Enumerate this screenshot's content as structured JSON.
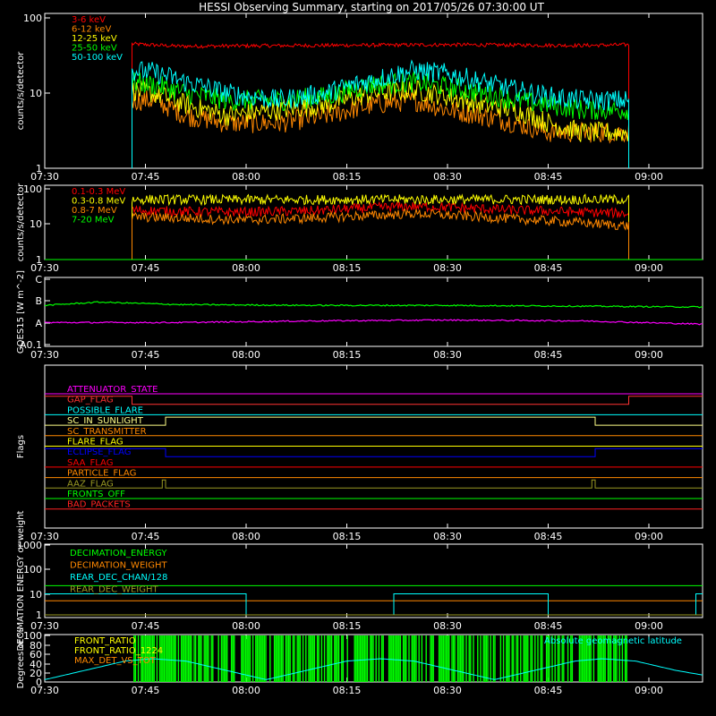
{
  "chart_data": {
    "type": "line",
    "title": "HESSI Observing Summary, starting on 2017/05/26 07:30:00 UT",
    "time_ticks": [
      "07:30",
      "07:45",
      "08:00",
      "08:15",
      "08:30",
      "08:45",
      "09:00"
    ],
    "time_range_min": [
      0,
      98
    ],
    "panels": [
      {
        "id": "low-energy",
        "ylabel": "counts/s/detector",
        "yscale": "log",
        "ylim": [
          1,
          100
        ],
        "ytick_labels": [
          "1",
          "10",
          "100"
        ],
        "series": [
          {
            "name": "3-6 keV",
            "color": "#ff0000",
            "values": [
              [
                13,
                45
              ],
              [
                20,
                42
              ],
              [
                40,
                43
              ],
              [
                60,
                44
              ],
              [
                80,
                43
              ],
              [
                87,
                44
              ]
            ]
          },
          {
            "name": "6-12 keV",
            "color": "#ff8800",
            "values": [
              [
                13,
                8
              ],
              [
                16,
                8
              ],
              [
                21,
                5
              ],
              [
                27,
                4
              ],
              [
                35,
                4
              ],
              [
                42,
                5
              ],
              [
                49,
                7
              ],
              [
                55,
                8
              ],
              [
                60,
                6
              ],
              [
                65,
                5
              ],
              [
                70,
                4
              ],
              [
                75,
                3
              ],
              [
                80,
                3
              ],
              [
                87,
                3
              ]
            ]
          },
          {
            "name": "12-25 keV",
            "color": "#ffff00",
            "values": [
              [
                13,
                11
              ],
              [
                16,
                10
              ],
              [
                21,
                7
              ],
              [
                27,
                5
              ],
              [
                35,
                6
              ],
              [
                42,
                7
              ],
              [
                49,
                10
              ],
              [
                55,
                11
              ],
              [
                60,
                9
              ],
              [
                65,
                7
              ],
              [
                70,
                6
              ],
              [
                75,
                4
              ],
              [
                80,
                3
              ],
              [
                87,
                3
              ]
            ]
          },
          {
            "name": "25-50 keV",
            "color": "#00ff00",
            "values": [
              [
                13,
                14
              ],
              [
                16,
                13
              ],
              [
                21,
                10
              ],
              [
                27,
                8
              ],
              [
                35,
                8
              ],
              [
                42,
                9
              ],
              [
                49,
                13
              ],
              [
                55,
                14
              ],
              [
                60,
                12
              ],
              [
                65,
                10
              ],
              [
                70,
                8
              ],
              [
                75,
                7
              ],
              [
                80,
                6
              ],
              [
                87,
                6
              ]
            ]
          },
          {
            "name": "50-100 keV",
            "color": "#00ffff",
            "values": [
              [
                13,
                20
              ],
              [
                16,
                19
              ],
              [
                21,
                14
              ],
              [
                27,
                10
              ],
              [
                35,
                8
              ],
              [
                42,
                10
              ],
              [
                49,
                15
              ],
              [
                55,
                20
              ],
              [
                60,
                18
              ],
              [
                65,
                14
              ],
              [
                70,
                11
              ],
              [
                75,
                9
              ],
              [
                80,
                8
              ],
              [
                87,
                8
              ]
            ]
          }
        ]
      },
      {
        "id": "high-energy",
        "ylabel": "counts/s/detector",
        "yscale": "log",
        "ylim": [
          1,
          100
        ],
        "ytick_labels": [
          "1",
          "10",
          "100"
        ],
        "series": [
          {
            "name": "0.1-0.3 MeV",
            "color": "#ff0000",
            "values": [
              [
                13,
                25
              ],
              [
                20,
                23
              ],
              [
                30,
                22
              ],
              [
                40,
                24
              ],
              [
                50,
                30
              ],
              [
                55,
                32
              ],
              [
                60,
                30
              ],
              [
                70,
                25
              ],
              [
                80,
                22
              ],
              [
                87,
                20
              ]
            ]
          },
          {
            "name": "0.3-0.8 MeV",
            "color": "#ffff00",
            "values": [
              [
                13,
                50
              ],
              [
                30,
                49
              ],
              [
                50,
                50
              ],
              [
                70,
                50
              ],
              [
                87,
                50
              ]
            ]
          },
          {
            "name": "0.8-7 MeV",
            "color": "#ff8800",
            "values": [
              [
                13,
                16
              ],
              [
                20,
                15
              ],
              [
                30,
                13
              ],
              [
                40,
                15
              ],
              [
                50,
                18
              ],
              [
                55,
                20
              ],
              [
                60,
                18
              ],
              [
                70,
                14
              ],
              [
                80,
                11
              ],
              [
                87,
                9
              ]
            ]
          },
          {
            "name": "7-20 MeV",
            "color": "#00ff00",
            "values": [
              [
                0,
                1
              ],
              [
                98,
                1
              ]
            ]
          }
        ]
      },
      {
        "id": "goes",
        "ylabel": "GOES15 [W m^-2]",
        "ytick_labels": [
          "A0.1",
          "A",
          "B",
          "C"
        ],
        "series": [
          {
            "name": "",
            "color": "#00ff00",
            "values": [
              [
                0,
                6.0
              ],
              [
                8,
                6.2
              ],
              [
                20,
                6.05
              ],
              [
                40,
                6.0
              ],
              [
                60,
                6.0
              ],
              [
                80,
                5.95
              ],
              [
                98,
                5.9
              ]
            ]
          },
          {
            "name": "",
            "color": "#ff00ff",
            "values": [
              [
                0,
                4.95
              ],
              [
                20,
                4.95
              ],
              [
                40,
                5.05
              ],
              [
                60,
                5.1
              ],
              [
                80,
                5.05
              ],
              [
                98,
                4.85
              ]
            ]
          }
        ]
      },
      {
        "id": "flags",
        "ylabel": "Flags",
        "flags": [
          {
            "name": "ATTENUATOR_STATE",
            "color": "#ff00ff",
            "values": [
              [
                0,
                0
              ],
              [
                98,
                0
              ]
            ]
          },
          {
            "name": "GAP_FLAG",
            "color": "#ff3333",
            "values": [
              [
                0,
                1
              ],
              [
                13,
                1
              ],
              [
                13,
                0
              ],
              [
                87,
                0
              ],
              [
                87,
                1
              ],
              [
                98,
                1
              ]
            ]
          },
          {
            "name": "POSSIBLE_FLARE",
            "color": "#00ffff",
            "values": [
              [
                0,
                0
              ],
              [
                98,
                0
              ]
            ]
          },
          {
            "name": "SC_IN_SUNLIGHT",
            "color": "#ffff88",
            "values": [
              [
                0,
                0
              ],
              [
                18,
                0
              ],
              [
                18,
                1
              ],
              [
                82,
                1
              ],
              [
                82,
                0
              ],
              [
                98,
                0
              ]
            ]
          },
          {
            "name": "SC_TRANSMITTER",
            "color": "#ff8800",
            "values": [
              [
                0,
                0
              ],
              [
                98,
                0
              ]
            ]
          },
          {
            "name": "FLARE_FLAG",
            "color": "#ffff00",
            "values": [
              [
                0,
                0
              ],
              [
                98,
                0
              ]
            ]
          },
          {
            "name": "ECLIPSE_FLAG",
            "color": "#0000ff",
            "values": [
              [
                0,
                1
              ],
              [
                18,
                1
              ],
              [
                18,
                0
              ],
              [
                82,
                0
              ],
              [
                82,
                1
              ],
              [
                98,
                1
              ]
            ]
          },
          {
            "name": "SAA_FLAG",
            "color": "#ff0000",
            "values": [
              [
                0,
                0
              ],
              [
                98,
                0
              ]
            ]
          },
          {
            "name": "PARTICLE_FLAG",
            "color": "#ff8800",
            "values": [
              [
                0,
                0
              ],
              [
                98,
                0
              ]
            ]
          },
          {
            "name": "AAZ_FLAG",
            "color": "#999922",
            "values": [
              [
                0,
                0
              ],
              [
                17.5,
                0
              ],
              [
                17.5,
                1
              ],
              [
                18,
                1
              ],
              [
                18,
                0
              ],
              [
                81.5,
                0
              ],
              [
                81.5,
                1
              ],
              [
                82,
                1
              ],
              [
                82,
                0
              ],
              [
                98,
                0
              ]
            ]
          },
          {
            "name": "FRONTS_OFF",
            "color": "#00ff00",
            "values": [
              [
                0,
                0
              ],
              [
                98,
                0
              ]
            ]
          },
          {
            "name": "BAD_PACKETS",
            "color": "#ff2222",
            "values": [
              [
                0,
                0
              ],
              [
                98,
                0
              ]
            ]
          }
        ]
      },
      {
        "id": "decimation",
        "ylabel": "DECIMATION ENERGY or weight",
        "yscale": "log",
        "ylim": [
          1,
          1000
        ],
        "ytick_labels": [
          "1",
          "10",
          "100",
          "1000"
        ],
        "series": [
          {
            "name": "DECIMATION_ENERGY",
            "color": "#00ff00",
            "values": [
              [
                0,
                18
              ],
              [
                98,
                18
              ]
            ]
          },
          {
            "name": "DECIMATION_WEIGHT",
            "color": "#ff8800",
            "values": [
              [
                0,
                4
              ],
              [
                98,
                4
              ]
            ]
          },
          {
            "name": "REAR_DEC_CHAN/128",
            "color": "#00ffff",
            "values": [
              [
                0,
                8
              ],
              [
                30,
                8
              ],
              [
                30,
                1
              ],
              [
                52,
                1
              ],
              [
                52,
                8
              ],
              [
                75,
                8
              ],
              [
                75,
                1
              ],
              [
                97,
                1
              ],
              [
                97,
                8
              ],
              [
                98,
                8
              ]
            ]
          },
          {
            "name": "REAR_DEC_WEIGHT",
            "color": "#999922",
            "values": [
              [
                0,
                1
              ],
              [
                98,
                1
              ]
            ]
          }
        ]
      },
      {
        "id": "ratios",
        "ylabel": "Degrees or %",
        "ylim": [
          0,
          100
        ],
        "ytick_labels": [
          "0",
          "20",
          "40",
          "60",
          "80",
          "100"
        ],
        "series": [
          {
            "name": "FRONT_RATIO",
            "color": "#ffff00",
            "values": []
          },
          {
            "name": "FRONT_RATIO_1224",
            "color": "#ffff00",
            "values": []
          },
          {
            "name": "MAX_DET_VS_TOT",
            "color": "#ff8800",
            "values": []
          }
        ],
        "green_fill_min": [
          13,
          87
        ],
        "annotation": "Absolute geomagnetic latitude",
        "latitude": [
          [
            0,
            5
          ],
          [
            6,
            25
          ],
          [
            12,
            45
          ],
          [
            16,
            50
          ],
          [
            21,
            45
          ],
          [
            27,
            25
          ],
          [
            33,
            5
          ],
          [
            39,
            25
          ],
          [
            45,
            45
          ],
          [
            50,
            50
          ],
          [
            55,
            45
          ],
          [
            61,
            25
          ],
          [
            67,
            5
          ],
          [
            73,
            25
          ],
          [
            79,
            45
          ],
          [
            83,
            50
          ],
          [
            88,
            45
          ],
          [
            94,
            25
          ],
          [
            98,
            15
          ]
        ]
      }
    ]
  }
}
